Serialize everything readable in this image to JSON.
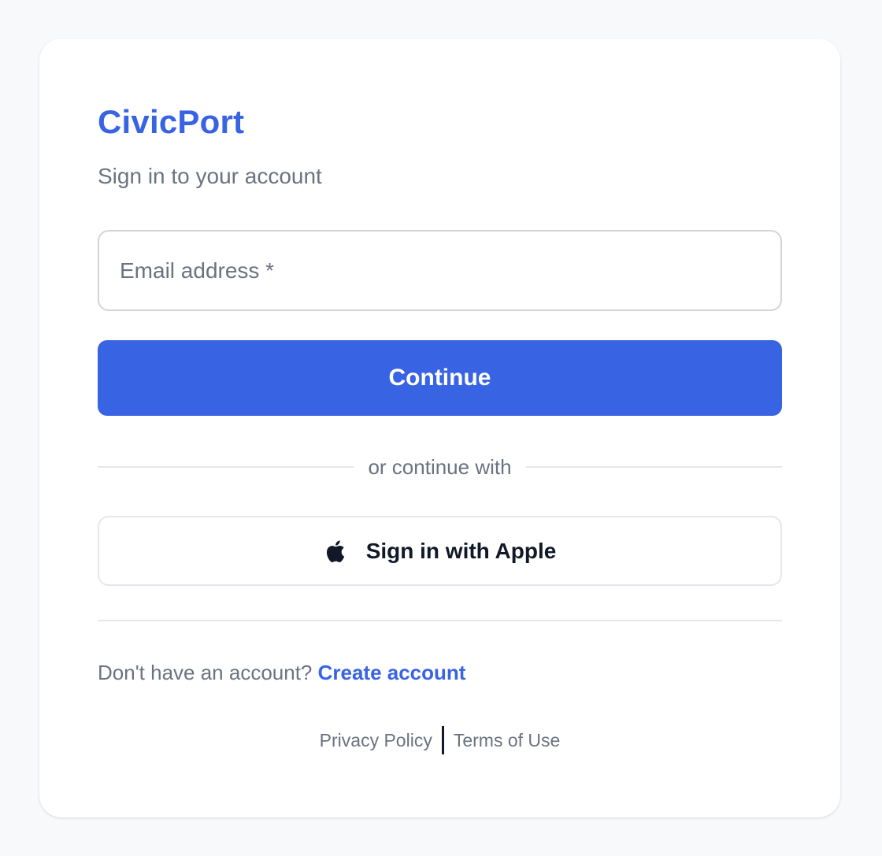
{
  "brand": {
    "name": "CivicPort"
  },
  "header": {
    "subtitle": "Sign in to your account"
  },
  "form": {
    "email_placeholder": "Email address *",
    "email_value": "",
    "continue_label": "Continue"
  },
  "divider": {
    "text": "or continue with"
  },
  "social": {
    "apple_label": "Sign in with Apple",
    "apple_icon": "apple-icon"
  },
  "signup": {
    "prompt": "Don't have an account?",
    "link_label": "Create account"
  },
  "footer": {
    "privacy_label": "Privacy Policy",
    "terms_label": "Terms of Use"
  },
  "colors": {
    "accent": "#3863e2",
    "background": "#f8f9fb",
    "card": "#ffffff",
    "muted_text": "#6b7280",
    "dark_text": "#111827",
    "border": "#d1d5db"
  }
}
